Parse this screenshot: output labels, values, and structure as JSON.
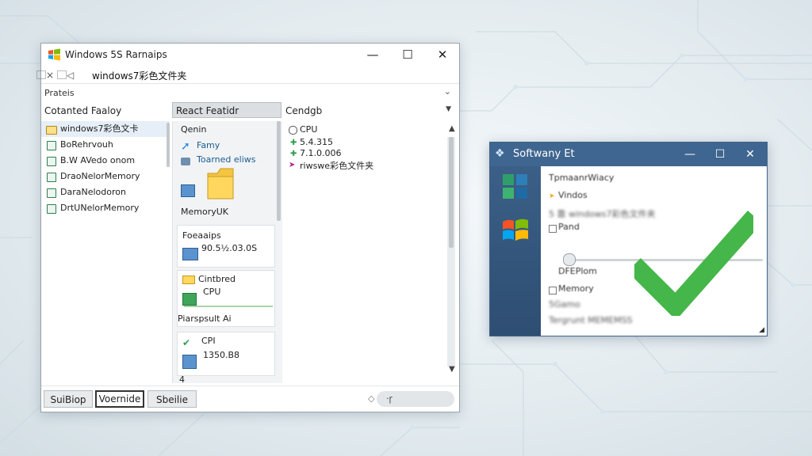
{
  "main_window": {
    "title": "Windows 5S Rarnaips",
    "controls": {
      "minimize": "—",
      "maximize": "☐",
      "close": "✕"
    },
    "address": {
      "back": "⃞×",
      "up": "⃞◁",
      "path": "windows7彩色文件夹"
    },
    "section_label": "Prateis",
    "section_arrow": "⌄",
    "columns": [
      "Cotanted Faaloy",
      "React Featidr",
      "Cendgb"
    ],
    "tree_items": [
      {
        "label": "windows7彩色文卡",
        "icon": "folder-yellow-icon"
      },
      {
        "label": "BoRehrvouh",
        "icon": "folder-green-icon"
      },
      {
        "label": "B.W AVedo onom",
        "icon": "folder-green-icon"
      },
      {
        "label": "DraoNelorMemory",
        "icon": "folder-green-icon"
      },
      {
        "label": "DaraNelodoron",
        "icon": "folder-green-icon"
      },
      {
        "label": "DrtUNelorMemory",
        "icon": "folder-green-icon"
      }
    ],
    "middle": {
      "header": "Qenin",
      "top_items": [
        "Famy",
        "Toarned eliws"
      ],
      "top_footer": "MemoryUK",
      "cards": [
        {
          "title": "Foeaaips",
          "value": "90.5½.03.0S"
        },
        {
          "title": "Cintbred",
          "value": "CPU",
          "footer": "Piarspsult Ai"
        },
        {
          "title": "CPI",
          "value": "1350.B8"
        }
      ],
      "footer_number": "4"
    },
    "right": {
      "header": "CPU",
      "values": [
        "5.4.315",
        "7.1.0.006",
        "riwswe彩色文件夹"
      ]
    },
    "bottom_buttons": [
      "SuiBiop",
      "Voernide",
      "Sbeilie"
    ],
    "status_text": "·ꞅ"
  },
  "secondary_window": {
    "title": "Softwany Et",
    "controls": {
      "minimize": "—",
      "maximize": "☐",
      "close": "✕"
    },
    "items": [
      "TpmaanrWiacy",
      "Vindos",
      "5 靠 windows7彩色文件夹",
      "Pand",
      "DFEPlom",
      "Memory",
      "5Gamo",
      "Tergrunt MEMEMSS"
    ],
    "resize": "◢"
  },
  "colors": {
    "accent_blue": "#3f6690",
    "check_green": "#45b649",
    "selection": "#e6eef8"
  }
}
